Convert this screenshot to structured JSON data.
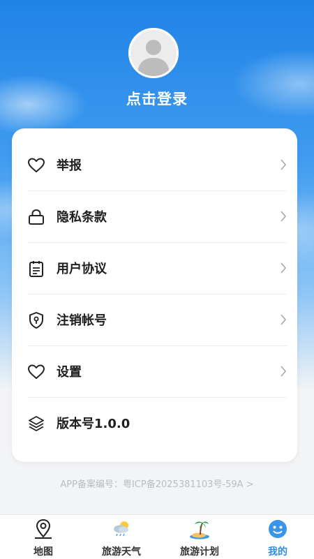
{
  "header": {
    "login_label": "点击登录"
  },
  "menu": {
    "items": [
      {
        "label": "举报",
        "icon": "heart-icon"
      },
      {
        "label": "隐私条款",
        "icon": "lock-icon"
      },
      {
        "label": "用户协议",
        "icon": "clipboard-icon"
      },
      {
        "label": "注销帐号",
        "icon": "shield-key-icon"
      },
      {
        "label": "设置",
        "icon": "heart-icon"
      },
      {
        "label": "版本号1.0.0",
        "icon": "layers-icon"
      }
    ]
  },
  "footer": {
    "icp": "APP备案编号：粤ICP备2025381103号-59A >"
  },
  "tabbar": {
    "tabs": [
      {
        "label": "地图",
        "icon": "map-pin-icon"
      },
      {
        "label": "旅游天气",
        "icon": "weather-icon"
      },
      {
        "label": "旅游计划",
        "icon": "island-icon"
      },
      {
        "label": "我的",
        "icon": "smiley-icon",
        "active": true
      }
    ]
  },
  "colors": {
    "accent": "#2b8de6",
    "sky_top": "#1f83e6"
  }
}
